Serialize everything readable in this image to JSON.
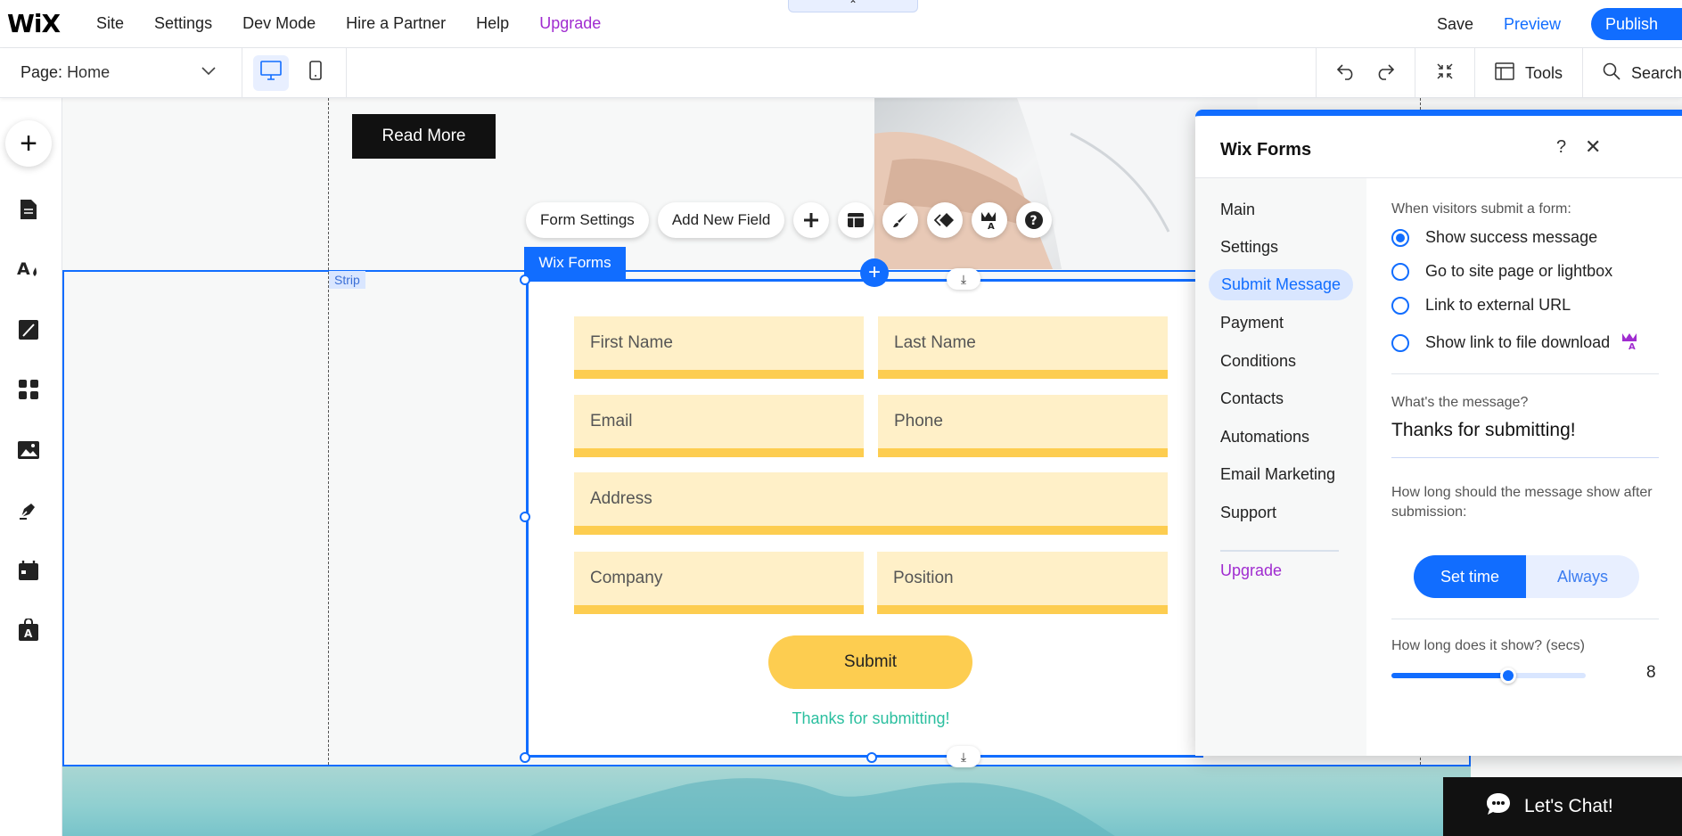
{
  "topbar": {
    "logo": "WiX",
    "nav": [
      "Site",
      "Settings",
      "Dev Mode",
      "Hire a Partner",
      "Help"
    ],
    "upgrade": "Upgrade",
    "save": "Save",
    "preview": "Preview",
    "publish": "Publish",
    "collapse_icon": "chevron-up-icon"
  },
  "secbar": {
    "page_label": "Page:",
    "page_value": "Home",
    "tools": "Tools",
    "search": "Search"
  },
  "canvas": {
    "read_more": "Read More",
    "strip_label": "Strip",
    "form_tag": "Wix Forms",
    "float_bar": {
      "form_settings": "Form Settings",
      "add_new_field": "Add New Field"
    },
    "fields": {
      "first_name": "First Name",
      "last_name": "Last Name",
      "email": "Email",
      "phone": "Phone",
      "address": "Address",
      "company": "Company",
      "position": "Position"
    },
    "submit": "Submit",
    "thanks": "Thanks for submitting!"
  },
  "panel": {
    "title": "Wix Forms",
    "help": "?",
    "nav": {
      "main": "Main",
      "settings": "Settings",
      "submit_message": "Submit Message",
      "payment": "Payment",
      "conditions": "Conditions",
      "contacts": "Contacts",
      "automations": "Automations",
      "email_marketing": "Email Marketing",
      "support": "Support",
      "upgrade": "Upgrade"
    },
    "when_label": "When visitors submit a form:",
    "options": {
      "success": "Show success message",
      "site_page": "Go to site page or lightbox",
      "external": "Link to external URL",
      "file": "Show link to file download"
    },
    "selected_option": "Show success message",
    "message_label": "What's the message?",
    "message_value": "Thanks for submitting!",
    "duration_label": "How long should the message show after submission:",
    "set_time": "Set time",
    "always": "Always",
    "seconds_label": "How long does it show? (secs)",
    "seconds_value": "8",
    "slider_fraction": 0.6
  },
  "chat": {
    "label": "Let's Chat!"
  },
  "colors": {
    "accent": "#116dff",
    "upgrade": "#a02cd0",
    "field_bg": "#fff0c8",
    "field_line": "#fdcd50",
    "thanks": "#2bbf9f"
  }
}
